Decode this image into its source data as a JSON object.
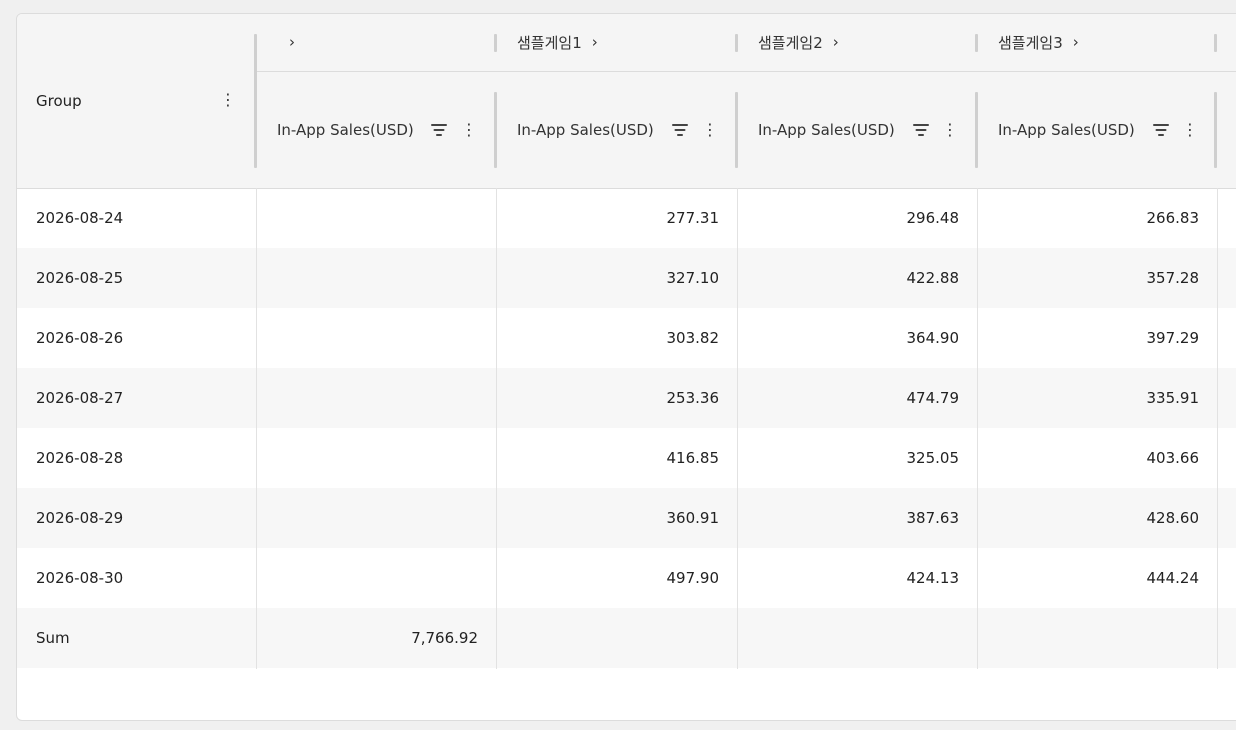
{
  "header": {
    "group_label": "Group",
    "groups": [
      {
        "label": "",
        "col_label": "In-App Sales(USD)"
      },
      {
        "label": "샘플게임1",
        "col_label": "In-App Sales(USD)"
      },
      {
        "label": "샘플게임2",
        "col_label": "In-App Sales(USD)"
      },
      {
        "label": "샘플게임3",
        "col_label": "In-App Sales(USD)"
      }
    ],
    "chevron": "›"
  },
  "rows": [
    {
      "group": "2026-08-24",
      "c0": "",
      "c1": "277.31",
      "c2": "296.48",
      "c3": "266.83"
    },
    {
      "group": "2026-08-25",
      "c0": "",
      "c1": "327.10",
      "c2": "422.88",
      "c3": "357.28"
    },
    {
      "group": "2026-08-26",
      "c0": "",
      "c1": "303.82",
      "c2": "364.90",
      "c3": "397.29"
    },
    {
      "group": "2026-08-27",
      "c0": "",
      "c1": "253.36",
      "c2": "474.79",
      "c3": "335.91"
    },
    {
      "group": "2026-08-28",
      "c0": "",
      "c1": "416.85",
      "c2": "325.05",
      "c3": "403.66"
    },
    {
      "group": "2026-08-29",
      "c0": "",
      "c1": "360.91",
      "c2": "387.63",
      "c3": "428.60"
    },
    {
      "group": "2026-08-30",
      "c0": "",
      "c1": "497.90",
      "c2": "424.13",
      "c3": "444.24"
    }
  ],
  "sum_row": {
    "group": "Sum",
    "c0": "7,766.92",
    "c1": "",
    "c2": "",
    "c3": ""
  }
}
